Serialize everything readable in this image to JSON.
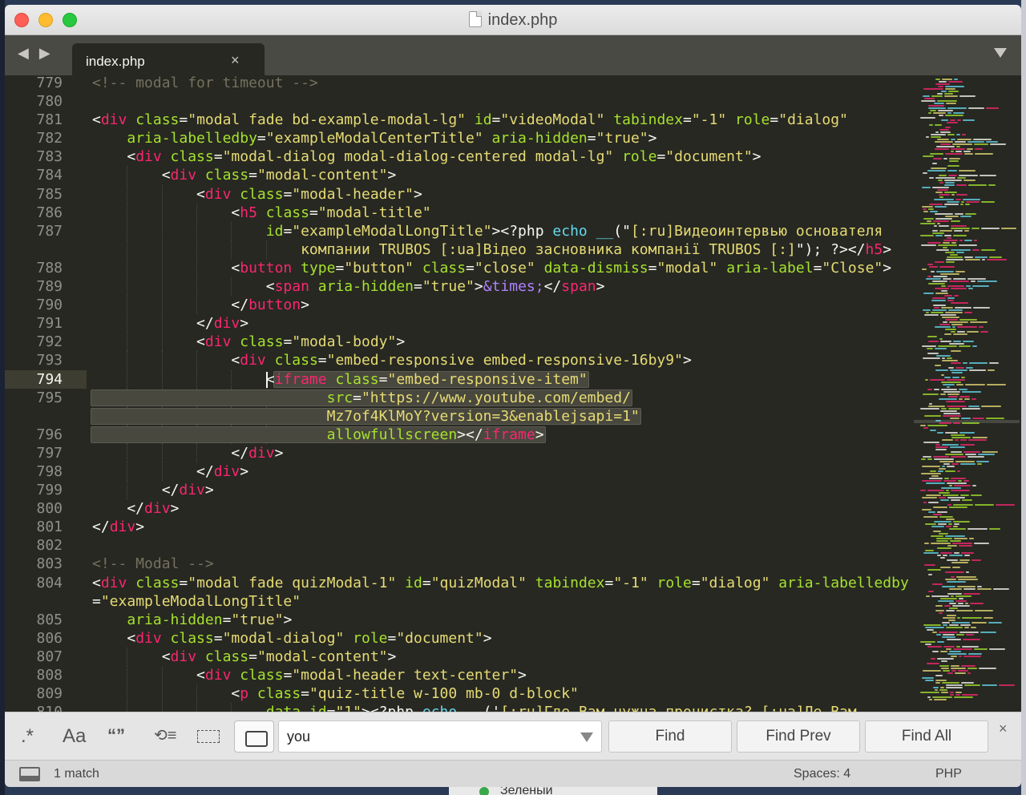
{
  "window": {
    "title": "index.php"
  },
  "tabs": {
    "nav_arrows": "◀ ▶",
    "active_label": "index.php",
    "close_glyph": "×"
  },
  "editor": {
    "active_line": "794",
    "lines": [
      {
        "n": "779",
        "segs": [
          {
            "c": "com",
            "t": "<!-- modal for timeout -->"
          }
        ]
      },
      {
        "n": "780",
        "segs": []
      },
      {
        "n": "781",
        "segs": [
          {
            "c": "",
            "t": "<"
          },
          {
            "c": "tag",
            "t": "div"
          },
          {
            "c": "",
            "t": " "
          },
          {
            "c": "attr",
            "t": "class"
          },
          {
            "c": "",
            "t": "="
          },
          {
            "c": "str",
            "t": "\"modal fade bd-example-modal-lg\""
          },
          {
            "c": "",
            "t": " "
          },
          {
            "c": "attr",
            "t": "id"
          },
          {
            "c": "",
            "t": "="
          },
          {
            "c": "str",
            "t": "\"videoModal\""
          },
          {
            "c": "",
            "t": " "
          },
          {
            "c": "attr",
            "t": "tabindex"
          },
          {
            "c": "",
            "t": "="
          },
          {
            "c": "str",
            "t": "\"-1\""
          },
          {
            "c": "",
            "t": " "
          },
          {
            "c": "attr",
            "t": "role"
          },
          {
            "c": "",
            "t": "="
          },
          {
            "c": "str",
            "t": "\"dialog\""
          }
        ]
      },
      {
        "n": "782",
        "segs": [
          {
            "c": "",
            "t": "    "
          },
          {
            "c": "attr",
            "t": "aria-labelledby"
          },
          {
            "c": "",
            "t": "="
          },
          {
            "c": "str",
            "t": "\"exampleModalCenterTitle\""
          },
          {
            "c": "",
            "t": " "
          },
          {
            "c": "attr",
            "t": "aria-hidden"
          },
          {
            "c": "",
            "t": "="
          },
          {
            "c": "str",
            "t": "\"true\""
          },
          {
            "c": "",
            "t": ">"
          }
        ]
      },
      {
        "n": "783",
        "segs": [
          {
            "c": "",
            "t": "    <"
          },
          {
            "c": "tag",
            "t": "div"
          },
          {
            "c": "",
            "t": " "
          },
          {
            "c": "attr",
            "t": "class"
          },
          {
            "c": "",
            "t": "="
          },
          {
            "c": "str",
            "t": "\"modal-dialog modal-dialog-centered modal-lg\""
          },
          {
            "c": "",
            "t": " "
          },
          {
            "c": "attr",
            "t": "role"
          },
          {
            "c": "",
            "t": "="
          },
          {
            "c": "str",
            "t": "\"document\""
          },
          {
            "c": "",
            "t": ">"
          }
        ]
      },
      {
        "n": "784",
        "segs": [
          {
            "c": "",
            "t": "        <"
          },
          {
            "c": "tag",
            "t": "div"
          },
          {
            "c": "",
            "t": " "
          },
          {
            "c": "attr",
            "t": "class"
          },
          {
            "c": "",
            "t": "="
          },
          {
            "c": "str",
            "t": "\"modal-content\""
          },
          {
            "c": "",
            "t": ">"
          }
        ]
      },
      {
        "n": "785",
        "segs": [
          {
            "c": "",
            "t": "            <"
          },
          {
            "c": "tag",
            "t": "div"
          },
          {
            "c": "",
            "t": " "
          },
          {
            "c": "attr",
            "t": "class"
          },
          {
            "c": "",
            "t": "="
          },
          {
            "c": "str",
            "t": "\"modal-header\""
          },
          {
            "c": "",
            "t": ">"
          }
        ]
      },
      {
        "n": "786",
        "segs": [
          {
            "c": "",
            "t": "                <"
          },
          {
            "c": "tag",
            "t": "h5"
          },
          {
            "c": "",
            "t": " "
          },
          {
            "c": "attr",
            "t": "class"
          },
          {
            "c": "",
            "t": "="
          },
          {
            "c": "str",
            "t": "\"modal-title\""
          }
        ]
      },
      {
        "n": "787",
        "segs": [
          {
            "c": "",
            "t": "                    "
          },
          {
            "c": "attr",
            "t": "id"
          },
          {
            "c": "",
            "t": "="
          },
          {
            "c": "str",
            "t": "\"exampleModalLongTitle\""
          },
          {
            "c": "",
            "t": "><?php "
          },
          {
            "c": "fn",
            "t": "echo"
          },
          {
            "c": "",
            "t": " "
          },
          {
            "c": "fn",
            "t": "__"
          },
          {
            "c": "",
            "t": "(\""
          },
          {
            "c": "str",
            "t": "[:ru]Видеоинтервью основателя"
          }
        ]
      },
      {
        "n": "",
        "segs": [
          {
            "c": "",
            "t": "                        "
          },
          {
            "c": "str",
            "t": "компании TRUBOS [:ua]Відео засновника компанії TRUBOS [:]"
          },
          {
            "c": "",
            "t": "\"); ?></"
          },
          {
            "c": "tag",
            "t": "h5"
          },
          {
            "c": "",
            "t": ">"
          }
        ]
      },
      {
        "n": "788",
        "segs": [
          {
            "c": "",
            "t": "                <"
          },
          {
            "c": "tag",
            "t": "button"
          },
          {
            "c": "",
            "t": " "
          },
          {
            "c": "attr",
            "t": "type"
          },
          {
            "c": "",
            "t": "="
          },
          {
            "c": "str",
            "t": "\"button\""
          },
          {
            "c": "",
            "t": " "
          },
          {
            "c": "attr",
            "t": "class"
          },
          {
            "c": "",
            "t": "="
          },
          {
            "c": "str",
            "t": "\"close\""
          },
          {
            "c": "",
            "t": " "
          },
          {
            "c": "attr",
            "t": "data-dismiss"
          },
          {
            "c": "",
            "t": "="
          },
          {
            "c": "str",
            "t": "\"modal\""
          },
          {
            "c": "",
            "t": " "
          },
          {
            "c": "attr",
            "t": "aria-label"
          },
          {
            "c": "",
            "t": "="
          },
          {
            "c": "str",
            "t": "\"Close\""
          },
          {
            "c": "",
            "t": ">"
          }
        ]
      },
      {
        "n": "789",
        "segs": [
          {
            "c": "",
            "t": "                    <"
          },
          {
            "c": "tag",
            "t": "span"
          },
          {
            "c": "",
            "t": " "
          },
          {
            "c": "attr",
            "t": "aria-hidden"
          },
          {
            "c": "",
            "t": "="
          },
          {
            "c": "str",
            "t": "\"true\""
          },
          {
            "c": "",
            "t": ">"
          },
          {
            "c": "ent",
            "t": "&times;"
          },
          {
            "c": "",
            "t": "</"
          },
          {
            "c": "tag",
            "t": "span"
          },
          {
            "c": "",
            "t": ">"
          }
        ]
      },
      {
        "n": "790",
        "segs": [
          {
            "c": "",
            "t": "                </"
          },
          {
            "c": "tag",
            "t": "button"
          },
          {
            "c": "",
            "t": ">"
          }
        ]
      },
      {
        "n": "791",
        "segs": [
          {
            "c": "",
            "t": "            </"
          },
          {
            "c": "tag",
            "t": "div"
          },
          {
            "c": "",
            "t": ">"
          }
        ]
      },
      {
        "n": "792",
        "segs": [
          {
            "c": "",
            "t": "            <"
          },
          {
            "c": "tag",
            "t": "div"
          },
          {
            "c": "",
            "t": " "
          },
          {
            "c": "attr",
            "t": "class"
          },
          {
            "c": "",
            "t": "="
          },
          {
            "c": "str",
            "t": "\"modal-body\""
          },
          {
            "c": "",
            "t": ">"
          }
        ]
      },
      {
        "n": "793",
        "segs": [
          {
            "c": "",
            "t": "                <"
          },
          {
            "c": "tag",
            "t": "div"
          },
          {
            "c": "",
            "t": " "
          },
          {
            "c": "attr",
            "t": "class"
          },
          {
            "c": "",
            "t": "="
          },
          {
            "c": "str",
            "t": "\"embed-responsive embed-responsive-16by9\""
          },
          {
            "c": "",
            "t": ">"
          }
        ]
      },
      {
        "n": "794",
        "segs": [
          {
            "c": "",
            "t": "                    <"
          },
          {
            "c": "tag",
            "t": "iframe"
          },
          {
            "c": "",
            "t": " "
          },
          {
            "c": "attr",
            "t": "class"
          },
          {
            "c": "",
            "t": "="
          },
          {
            "c": "str",
            "t": "\"embed-responsive-item\""
          }
        ]
      },
      {
        "n": "795",
        "segs": [
          {
            "c": "",
            "t": "                           "
          },
          {
            "c": "attr",
            "t": "src"
          },
          {
            "c": "",
            "t": "="
          },
          {
            "c": "str",
            "t": "\"https://www.youtube.com/embed/"
          }
        ]
      },
      {
        "n": "",
        "segs": [
          {
            "c": "",
            "t": "                           "
          },
          {
            "c": "str",
            "t": "Mz7of4KlMoY?version=3&enablejsapi=1\""
          }
        ]
      },
      {
        "n": "796",
        "segs": [
          {
            "c": "",
            "t": "                           "
          },
          {
            "c": "attr",
            "t": "allowfullscreen"
          },
          {
            "c": "",
            "t": "></"
          },
          {
            "c": "tag",
            "t": "iframe"
          },
          {
            "c": "",
            "t": ">"
          }
        ]
      },
      {
        "n": "797",
        "segs": [
          {
            "c": "",
            "t": "                </"
          },
          {
            "c": "tag",
            "t": "div"
          },
          {
            "c": "",
            "t": ">"
          }
        ]
      },
      {
        "n": "798",
        "segs": [
          {
            "c": "",
            "t": "            </"
          },
          {
            "c": "tag",
            "t": "div"
          },
          {
            "c": "",
            "t": ">"
          }
        ]
      },
      {
        "n": "799",
        "segs": [
          {
            "c": "",
            "t": "        </"
          },
          {
            "c": "tag",
            "t": "div"
          },
          {
            "c": "",
            "t": ">"
          }
        ]
      },
      {
        "n": "800",
        "segs": [
          {
            "c": "",
            "t": "    </"
          },
          {
            "c": "tag",
            "t": "div"
          },
          {
            "c": "",
            "t": ">"
          }
        ]
      },
      {
        "n": "801",
        "segs": [
          {
            "c": "",
            "t": "</"
          },
          {
            "c": "tag",
            "t": "div"
          },
          {
            "c": "",
            "t": ">"
          }
        ]
      },
      {
        "n": "802",
        "segs": []
      },
      {
        "n": "803",
        "segs": [
          {
            "c": "com",
            "t": "<!-- Modal -->"
          }
        ]
      },
      {
        "n": "804",
        "segs": [
          {
            "c": "",
            "t": "<"
          },
          {
            "c": "tag",
            "t": "div"
          },
          {
            "c": "",
            "t": " "
          },
          {
            "c": "attr",
            "t": "class"
          },
          {
            "c": "",
            "t": "="
          },
          {
            "c": "str",
            "t": "\"modal fade quizModal-1\""
          },
          {
            "c": "",
            "t": " "
          },
          {
            "c": "attr",
            "t": "id"
          },
          {
            "c": "",
            "t": "="
          },
          {
            "c": "str",
            "t": "\"quizModal\""
          },
          {
            "c": "",
            "t": " "
          },
          {
            "c": "attr",
            "t": "tabindex"
          },
          {
            "c": "",
            "t": "="
          },
          {
            "c": "str",
            "t": "\"-1\""
          },
          {
            "c": "",
            "t": " "
          },
          {
            "c": "attr",
            "t": "role"
          },
          {
            "c": "",
            "t": "="
          },
          {
            "c": "str",
            "t": "\"dialog\""
          },
          {
            "c": "",
            "t": " "
          },
          {
            "c": "attr",
            "t": "aria-labelledby"
          }
        ]
      },
      {
        "n": "",
        "segs": [
          {
            "c": "",
            "t": "="
          },
          {
            "c": "str",
            "t": "\"exampleModalLongTitle\""
          }
        ]
      },
      {
        "n": "805",
        "segs": [
          {
            "c": "",
            "t": "    "
          },
          {
            "c": "attr",
            "t": "aria-hidden"
          },
          {
            "c": "",
            "t": "="
          },
          {
            "c": "str",
            "t": "\"true\""
          },
          {
            "c": "",
            "t": ">"
          }
        ]
      },
      {
        "n": "806",
        "segs": [
          {
            "c": "",
            "t": "    <"
          },
          {
            "c": "tag",
            "t": "div"
          },
          {
            "c": "",
            "t": " "
          },
          {
            "c": "attr",
            "t": "class"
          },
          {
            "c": "",
            "t": "="
          },
          {
            "c": "str",
            "t": "\"modal-dialog\""
          },
          {
            "c": "",
            "t": " "
          },
          {
            "c": "attr",
            "t": "role"
          },
          {
            "c": "",
            "t": "="
          },
          {
            "c": "str",
            "t": "\"document\""
          },
          {
            "c": "",
            "t": ">"
          }
        ]
      },
      {
        "n": "807",
        "segs": [
          {
            "c": "",
            "t": "        <"
          },
          {
            "c": "tag",
            "t": "div"
          },
          {
            "c": "",
            "t": " "
          },
          {
            "c": "attr",
            "t": "class"
          },
          {
            "c": "",
            "t": "="
          },
          {
            "c": "str",
            "t": "\"modal-content\""
          },
          {
            "c": "",
            "t": ">"
          }
        ]
      },
      {
        "n": "808",
        "segs": [
          {
            "c": "",
            "t": "            <"
          },
          {
            "c": "tag",
            "t": "div"
          },
          {
            "c": "",
            "t": " "
          },
          {
            "c": "attr",
            "t": "class"
          },
          {
            "c": "",
            "t": "="
          },
          {
            "c": "str",
            "t": "\"modal-header text-center\""
          },
          {
            "c": "",
            "t": ">"
          }
        ]
      },
      {
        "n": "809",
        "segs": [
          {
            "c": "",
            "t": "                <"
          },
          {
            "c": "tag",
            "t": "p"
          },
          {
            "c": "",
            "t": " "
          },
          {
            "c": "attr",
            "t": "class"
          },
          {
            "c": "",
            "t": "="
          },
          {
            "c": "str",
            "t": "\"quiz-title w-100 mb-0 d-block\""
          }
        ]
      },
      {
        "n": "810",
        "segs": [
          {
            "c": "",
            "t": "                    "
          },
          {
            "c": "attr",
            "t": "data-id"
          },
          {
            "c": "",
            "t": "="
          },
          {
            "c": "str",
            "t": "\"1\""
          },
          {
            "c": "",
            "t": "><?php "
          },
          {
            "c": "fn",
            "t": "echo"
          },
          {
            "c": "",
            "t": " "
          },
          {
            "c": "fn",
            "t": "__"
          },
          {
            "c": "",
            "t": "('"
          },
          {
            "c": "str",
            "t": "[:ru]Где Вам нужна прочистка? [:ua]Де Вам"
          }
        ]
      }
    ]
  },
  "find": {
    "option_regex": ".*",
    "option_case": "Aa",
    "option_word": "“”",
    "option_wrap": "⟲≡",
    "query": "you",
    "find_label": "Find",
    "find_prev_label": "Find Prev",
    "find_all_label": "Find All",
    "close_glyph": "×"
  },
  "status": {
    "matches": "1 match",
    "spaces": "Spaces: 4",
    "syntax": "PHP"
  },
  "desktop": {
    "peek_label": "Зеленый"
  },
  "colors": {
    "editor_bg": "#272822",
    "tag": "#f92672",
    "attr": "#a6e22e",
    "string": "#e6db74",
    "comment": "#75715e",
    "function": "#66d9ef",
    "entity": "#ae81ff"
  }
}
